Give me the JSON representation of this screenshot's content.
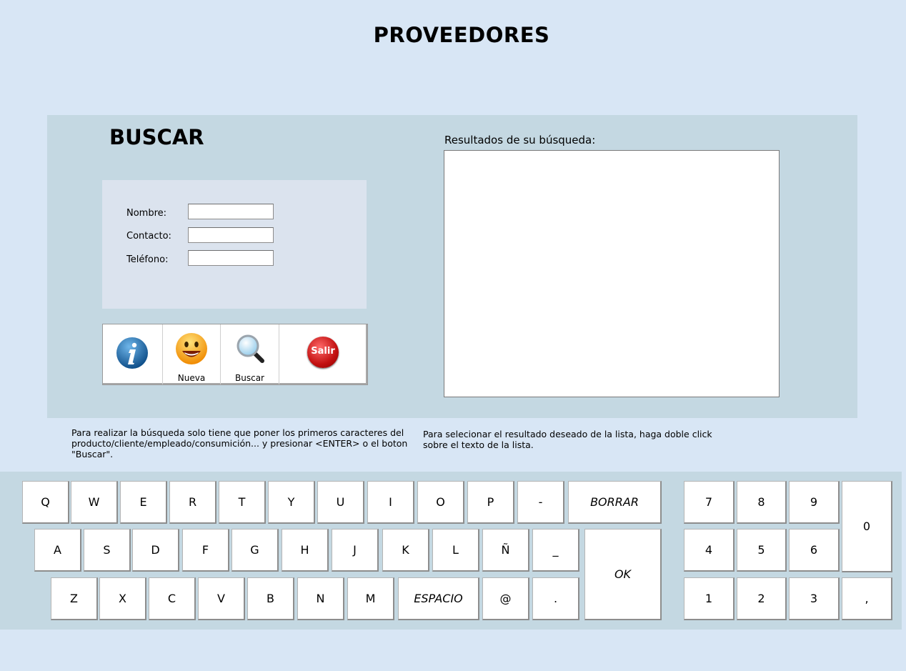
{
  "title": "PROVEEDORES",
  "search": {
    "heading": "BUSCAR",
    "fields": [
      {
        "label": "Nombre:",
        "value": ""
      },
      {
        "label": "Contacto:",
        "value": ""
      },
      {
        "label": "Teléfono:",
        "value": ""
      }
    ]
  },
  "toolbar": {
    "info_label": "",
    "nueva_label": "Nueva",
    "buscar_label": "Buscar",
    "salir_label": "Salir"
  },
  "results": {
    "label": "Resultados de su búsqueda:",
    "items": []
  },
  "help": {
    "left": "Para realizar la búsqueda solo tiene que poner los primeros caracteres del producto/cliente/empleado/consumición... y presionar <ENTER> o el boton \"Buscar\".",
    "right": "Para selecionar el resultado deseado de la lista, haga doble click sobre el texto de la lista."
  },
  "keyboard": {
    "row1": [
      "Q",
      "W",
      "E",
      "R",
      "T",
      "Y",
      "U",
      "I",
      "O",
      "P",
      "-"
    ],
    "row2": [
      "A",
      "S",
      "D",
      "F",
      "G",
      "H",
      "J",
      "K",
      "L",
      "Ñ",
      "_"
    ],
    "row3": [
      "Z",
      "X",
      "C",
      "V",
      "B",
      "N",
      "M",
      "ESPACIO",
      "@",
      "."
    ],
    "borrar": "BORRAR",
    "ok": "OK",
    "numpad": [
      "7",
      "8",
      "9",
      "4",
      "5",
      "6",
      "1",
      "2",
      "3"
    ],
    "zero": "0",
    "comma": ","
  },
  "colors": {
    "background": "#d8e6f5",
    "panel": "#c4d8e2",
    "form_box": "#dbe3ee"
  }
}
